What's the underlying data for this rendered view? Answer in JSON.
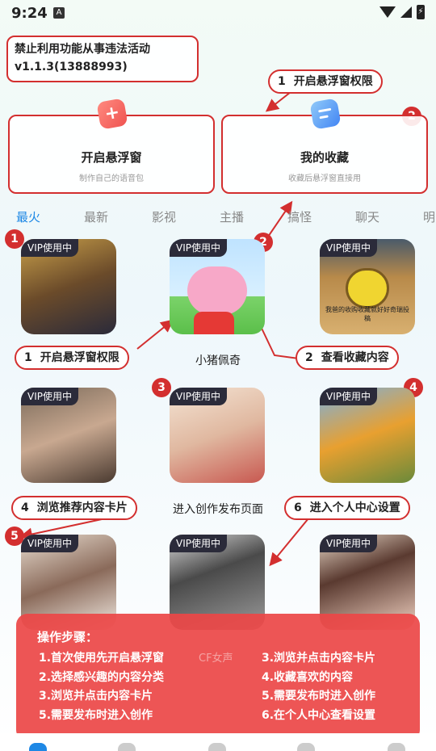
{
  "status": {
    "time": "9:24",
    "notif_icon": "A"
  },
  "warning": {
    "line1": "禁止利用功能从事违法活动",
    "line2": "v1.1.3(13888993)"
  },
  "callouts": {
    "c1": {
      "num": "1",
      "text": "开启悬浮窗权限"
    },
    "c2": {
      "num": "1",
      "text": "开启悬浮窗权限"
    },
    "c3": {
      "num": "2",
      "text": "查看收藏内容"
    },
    "c4": {
      "num": "4",
      "text": "浏览推荐内容卡片"
    },
    "c5": {
      "num": "6",
      "text": "进入个人中心设置"
    }
  },
  "badges": [
    "1",
    "2",
    "2",
    "3",
    "4",
    "5"
  ],
  "cards": {
    "float": {
      "title": "开启悬浮窗",
      "sub": "制作自己的语音包",
      "icon": "plus-icon"
    },
    "fav": {
      "title": "我的收藏",
      "sub": "收藏后悬浮窗直接用",
      "icon": "list-icon"
    }
  },
  "tabs": [
    "最火",
    "最新",
    "影视",
    "主播",
    "搞怪",
    "聊天",
    "明"
  ],
  "vip_label": "VIP使用中",
  "tiles": {
    "t2_title": "小猪佩奇",
    "row2_caption": "进入创作发布页面",
    "t3_caption": "我爸的收购收藏就好好奇瑞投稿",
    "row4_partial": "CF女声"
  },
  "steps": {
    "heading": "操作步骤：",
    "left": [
      "1.首次使用先开启悬浮窗",
      "2.选择感兴趣的内容分类",
      "3.浏览并点击内容卡片",
      "5.需要发布时进入创作"
    ],
    "right": [
      "3.浏览并点击内容卡片",
      "4.收藏喜欢的内容",
      "5.需要发布时进入创作",
      "6.在个人中心查看设置"
    ]
  },
  "colors": {
    "accent_red": "#d32f2f",
    "tab_active": "#1e88e5",
    "vip_bg": "#2b2b3a"
  }
}
